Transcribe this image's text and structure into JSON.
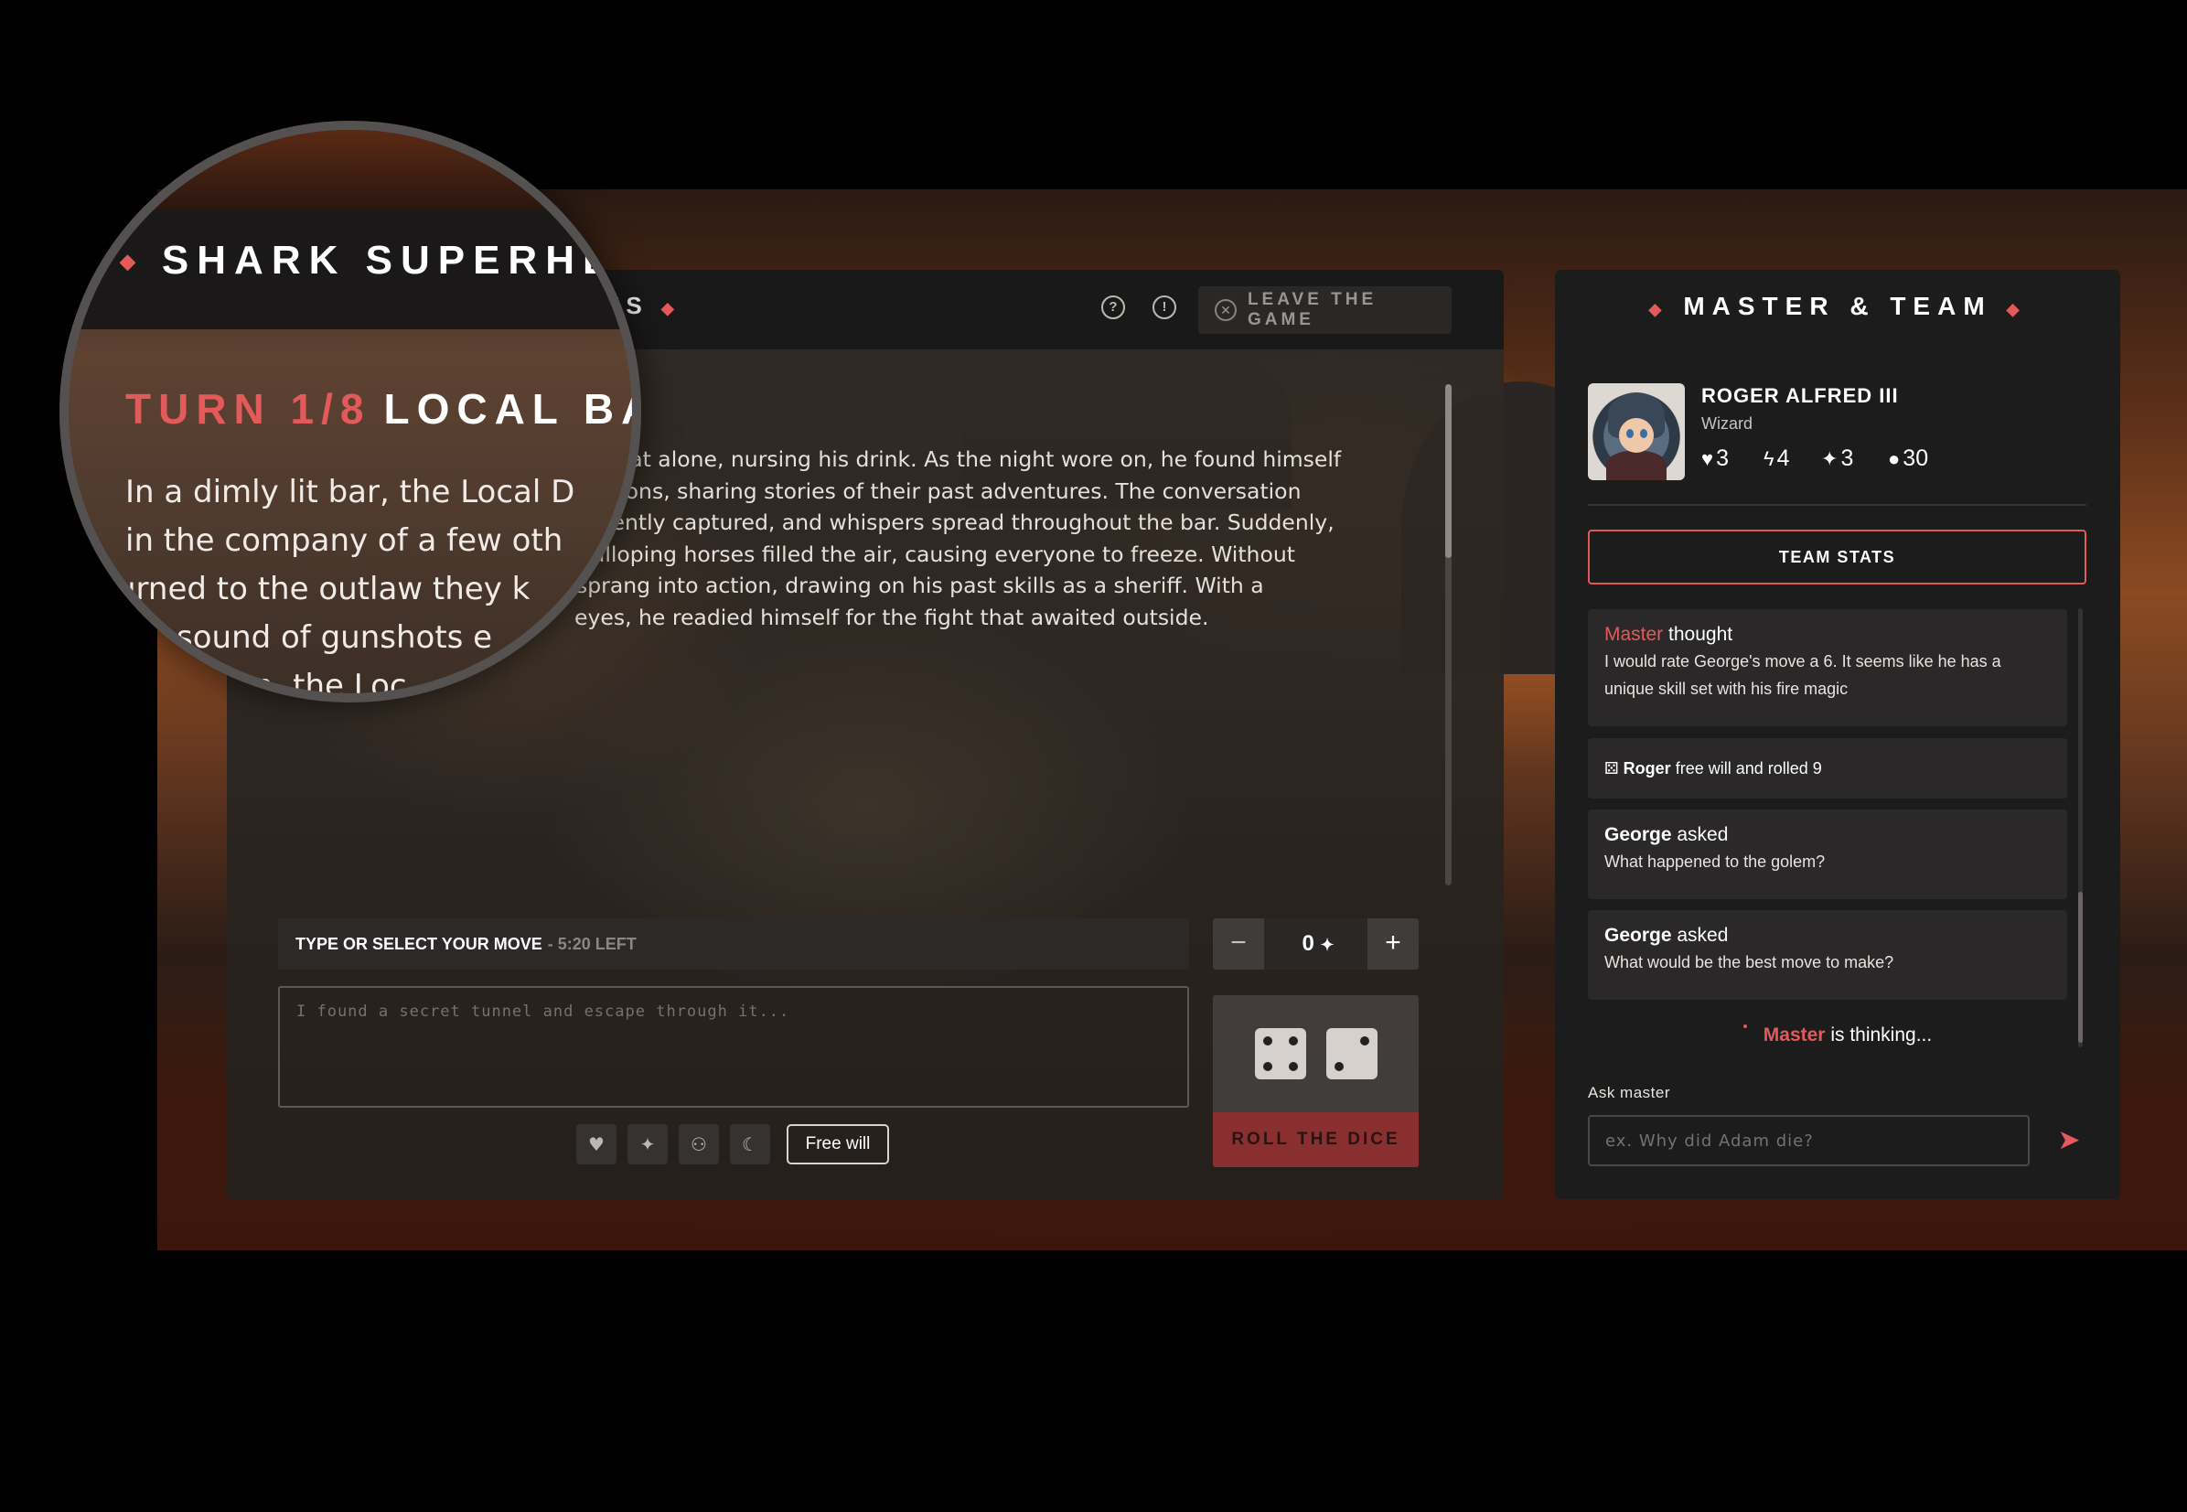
{
  "game": {
    "title_visible": "ES",
    "help_icon": "help-circle-icon",
    "info_icon": "info-circle-icon",
    "leave_label": "LEAVE THE GAME",
    "story_lines": [
      "nk sat alone, nursing his drink. As the night wore on, he found himself",
      "patrons, sharing stories of their past adventures. The conversation",
      "recently captured, and whispers spread throughout the bar. Suddenly,",
      "galloping horses filled the air, causing everyone to freeze. Without",
      "sprang into action, drawing on his past skills as a sheriff. With a",
      "eyes, he readied himself for the fight that awaited outside."
    ],
    "move_label": "TYPE OR SELECT YOUR MOVE",
    "move_time": "- 5:20 LEFT",
    "move_placeholder": "I found a secret tunnel and escape through it...",
    "free_will_label": "Free will",
    "bonus_value": "0",
    "minus_label": "−",
    "plus_label": "+",
    "roll_label": "ROLL THE DICE",
    "dice": [
      4,
      2
    ]
  },
  "magnifier": {
    "title": "SHARK SUPERHE",
    "turn": "TURN 1/8",
    "location": "LOCAL BA",
    "story_lines": [
      "In a dimly lit bar, the Local D",
      "in the company of a few oth",
      "urned to the outlaw they k",
      "sound of gunshots e",
      "n, the Loc"
    ]
  },
  "team": {
    "title": "MASTER & TEAM",
    "character": {
      "name": "ROGER ALFRED III",
      "class": "Wizard",
      "stats": {
        "health": "3",
        "power": "4",
        "magic": "3",
        "coins": "30"
      }
    },
    "team_stats_label": "TEAM STATS",
    "feed": [
      {
        "actor": "Master",
        "action": "thought",
        "body": [
          "I would rate George's move a 6. It seems like he has a",
          "unique skill set with his fire magic"
        ]
      },
      {
        "actor": "Roger",
        "action": "free will and rolled 9"
      },
      {
        "actor": "George",
        "action": "asked",
        "body": [
          "What happened to the golem?"
        ]
      },
      {
        "actor": "George",
        "action": "asked",
        "body": [
          "What would be the best move to make?"
        ]
      }
    ],
    "thinking_actor": "Master",
    "thinking_text": "is thinking...",
    "ask_label": "Ask master",
    "ask_placeholder": "ex. Why did Adam die?"
  },
  "colors": {
    "accent": "#e35a5a",
    "panel": "#1d1c1c",
    "roll_button": "#8a2f2f"
  }
}
